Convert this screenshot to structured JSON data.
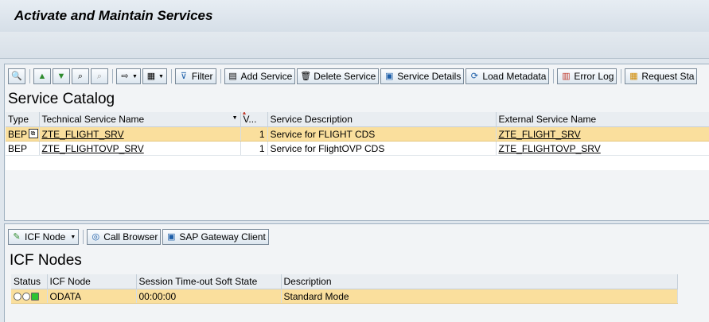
{
  "window": {
    "title": "Activate and Maintain Services"
  },
  "catalog": {
    "toolbar": {
      "filter_label": "Filter",
      "add_service_label": "Add Service",
      "delete_service_label": "Delete Service",
      "service_details_label": "Service Details",
      "load_metadata_label": "Load Metadata",
      "error_log_label": "Error Log",
      "request_status_label": "Request Sta"
    },
    "section_title": "Service Catalog",
    "columns": [
      "Type",
      "Technical Service Name",
      "V...",
      "Service Description",
      "External Service Name"
    ],
    "rows": [
      {
        "type": "BEP",
        "technical_name": "ZTE_FLIGHT_SRV",
        "version": "1",
        "description": "Service for FLIGHT CDS",
        "external_name": "ZTE_FLIGHT_SRV",
        "selected": true
      },
      {
        "type": "BEP",
        "technical_name": "ZTE_FLIGHTOVP_SRV",
        "version": "1",
        "description": "Service for FlightOVP CDS",
        "external_name": "ZTE_FLIGHTOVP_SRV",
        "selected": false
      }
    ]
  },
  "icf": {
    "toolbar": {
      "icf_node_label": "ICF Node",
      "call_browser_label": "Call Browser",
      "gateway_client_label": "SAP Gateway Client"
    },
    "section_title": "ICF Nodes",
    "columns": [
      "Status",
      "ICF Node",
      "Session Time-out Soft State",
      "Description"
    ],
    "rows": [
      {
        "status": "active",
        "node": "ODATA",
        "timeout": "00:00:00",
        "description": "Standard Mode"
      }
    ]
  },
  "colors": {
    "selection": "#fadf9d",
    "status_green": "#2ec431",
    "panel_bg": "#f2f4f6"
  }
}
